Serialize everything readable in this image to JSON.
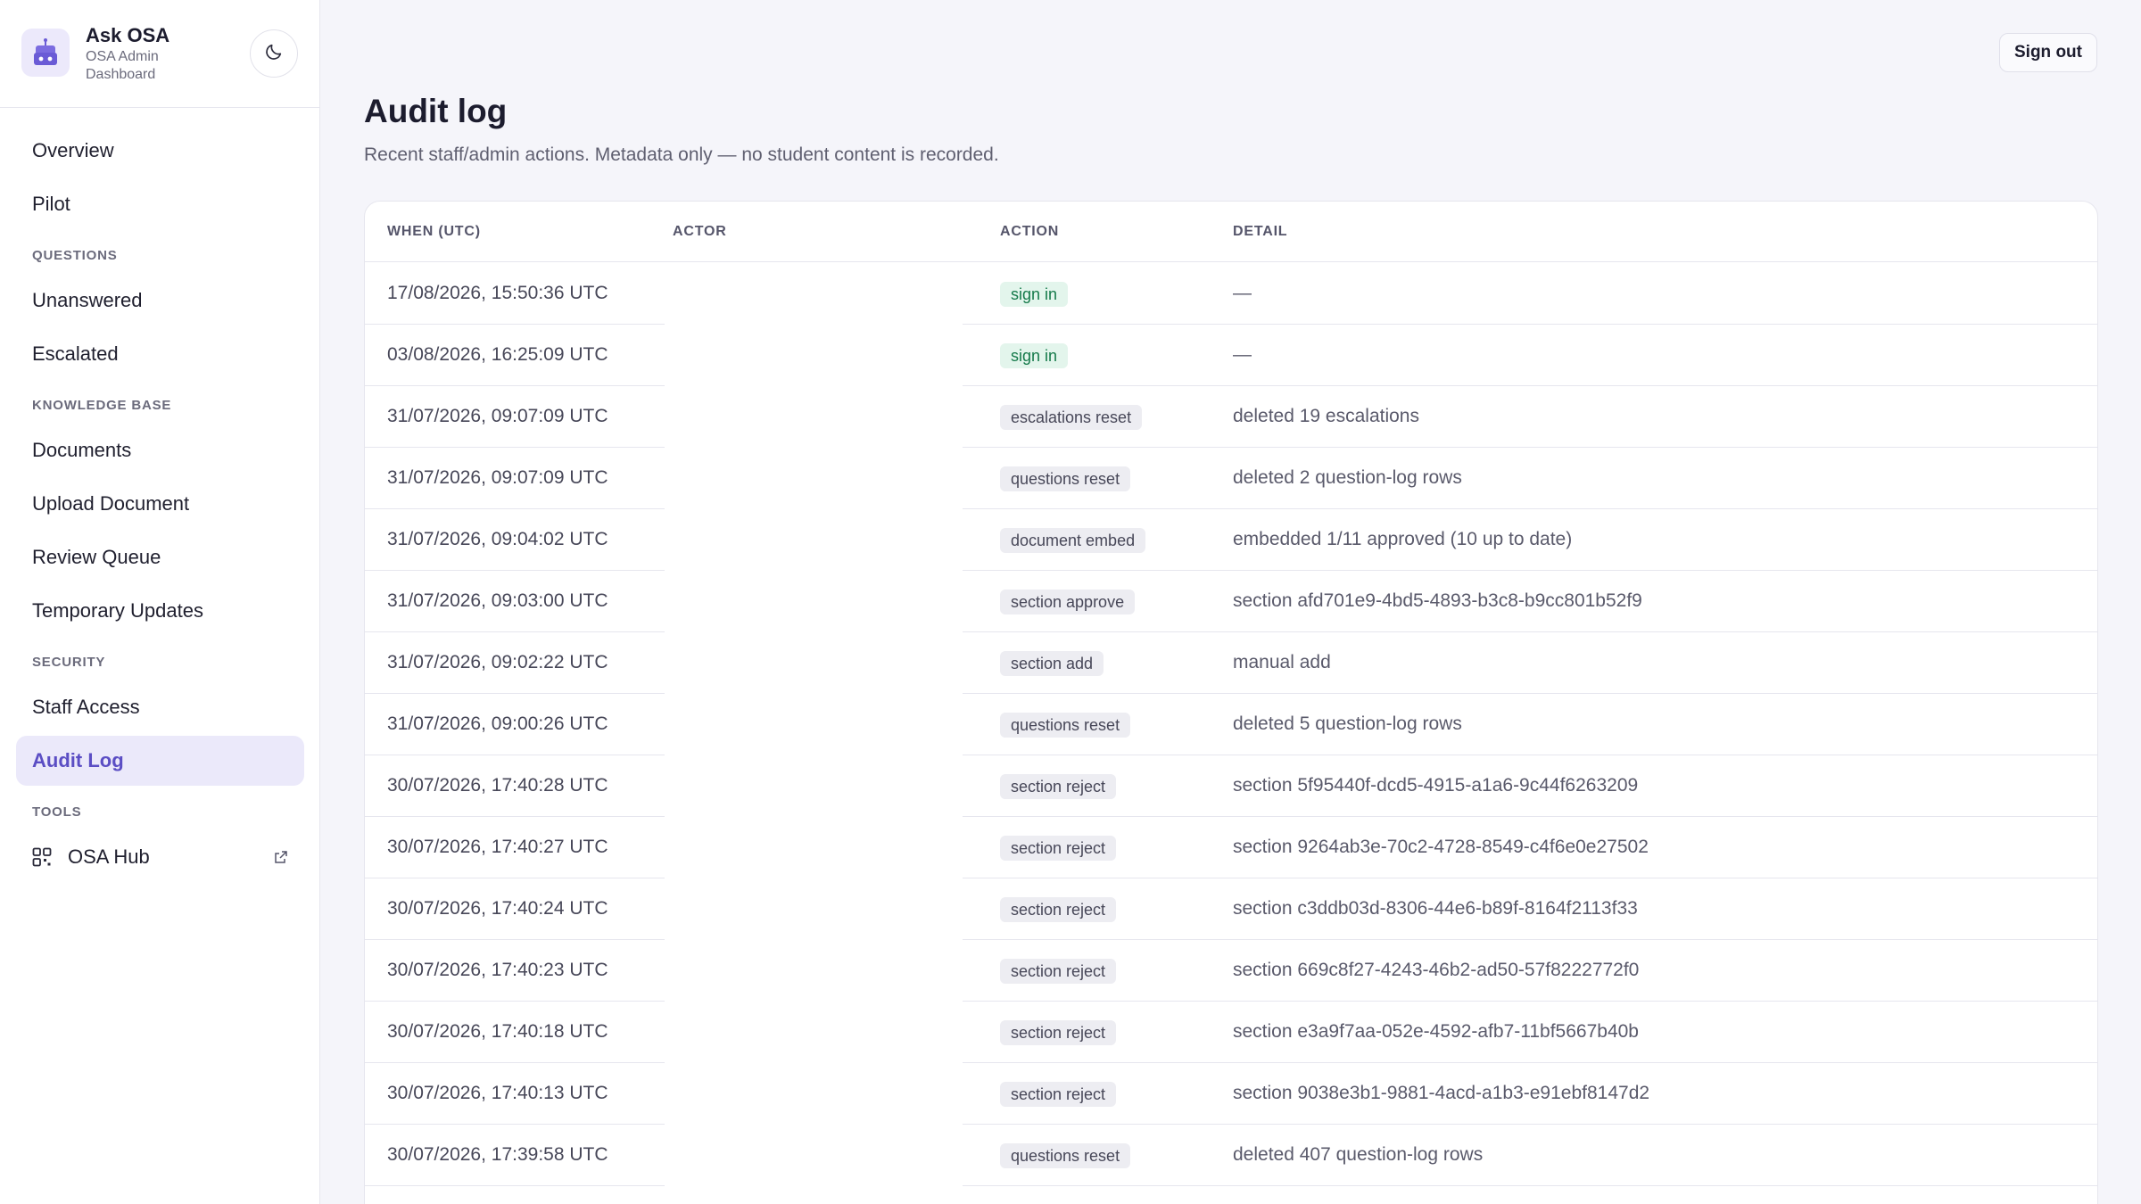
{
  "brand": {
    "title": "Ask OSA",
    "subtitle": "OSA Admin Dashboard"
  },
  "topbar": {
    "signout_label": "Sign out"
  },
  "sidebar": {
    "groups": [
      {
        "section": "",
        "items": [
          {
            "label": "Overview",
            "active": false
          },
          {
            "label": "Pilot",
            "active": false
          }
        ]
      },
      {
        "section": "QUESTIONS",
        "items": [
          {
            "label": "Unanswered",
            "active": false
          },
          {
            "label": "Escalated",
            "active": false
          }
        ]
      },
      {
        "section": "KNOWLEDGE BASE",
        "items": [
          {
            "label": "Documents",
            "active": false
          },
          {
            "label": "Upload Document",
            "active": false
          },
          {
            "label": "Review Queue",
            "active": false
          },
          {
            "label": "Temporary Updates",
            "active": false
          }
        ]
      },
      {
        "section": "SECURITY",
        "items": [
          {
            "label": "Staff Access",
            "active": false
          },
          {
            "label": "Audit Log",
            "active": true
          }
        ]
      },
      {
        "section": "TOOLS",
        "items": [
          {
            "label": "OSA Hub",
            "active": false,
            "icon": "grid-icon",
            "external": true
          }
        ]
      }
    ]
  },
  "main": {
    "title": "Audit log",
    "subtitle": "Recent staff/admin actions. Metadata only — no student content is recorded."
  },
  "table": {
    "headers": [
      "WHEN (UTC)",
      "ACTOR",
      "ACTION",
      "DETAIL"
    ],
    "rows": [
      {
        "when": "17/08/2026, 15:50:36 UTC",
        "actor": "",
        "action": "sign in",
        "detail": "—"
      },
      {
        "when": "03/08/2026, 16:25:09 UTC",
        "actor": "",
        "action": "sign in",
        "detail": "—"
      },
      {
        "when": "31/07/2026, 09:07:09 UTC",
        "actor": "",
        "action": "escalations reset",
        "detail": "deleted 19 escalations"
      },
      {
        "when": "31/07/2026, 09:07:09 UTC",
        "actor": "",
        "action": "questions reset",
        "detail": "deleted 2 question-log rows"
      },
      {
        "when": "31/07/2026, 09:04:02 UTC",
        "actor": "",
        "action": "document embed",
        "detail": "embedded 1/11 approved (10 up to date)"
      },
      {
        "when": "31/07/2026, 09:03:00 UTC",
        "actor": "",
        "action": "section approve",
        "detail": "section afd701e9-4bd5-4893-b3c8-b9cc801b52f9"
      },
      {
        "when": "31/07/2026, 09:02:22 UTC",
        "actor": "",
        "action": "section add",
        "detail": "manual add"
      },
      {
        "when": "31/07/2026, 09:00:26 UTC",
        "actor": "",
        "action": "questions reset",
        "detail": "deleted 5 question-log rows"
      },
      {
        "when": "30/07/2026, 17:40:28 UTC",
        "actor": "",
        "action": "section reject",
        "detail": "section 5f95440f-dcd5-4915-a1a6-9c44f6263209"
      },
      {
        "when": "30/07/2026, 17:40:27 UTC",
        "actor": "",
        "action": "section reject",
        "detail": "section 9264ab3e-70c2-4728-8549-c4f6e0e27502"
      },
      {
        "when": "30/07/2026, 17:40:24 UTC",
        "actor": "",
        "action": "section reject",
        "detail": "section c3ddb03d-8306-44e6-b89f-8164f2113f33"
      },
      {
        "when": "30/07/2026, 17:40:23 UTC",
        "actor": "",
        "action": "section reject",
        "detail": "section 669c8f27-4243-46b2-ad50-57f8222772f0"
      },
      {
        "when": "30/07/2026, 17:40:18 UTC",
        "actor": "",
        "action": "section reject",
        "detail": "section e3a9f7aa-052e-4592-afb7-11bf5667b40b"
      },
      {
        "when": "30/07/2026, 17:40:13 UTC",
        "actor": "",
        "action": "section reject",
        "detail": "section 9038e3b1-9881-4acd-a1b3-e91ebf8147d2"
      },
      {
        "when": "30/07/2026, 17:39:58 UTC",
        "actor": "",
        "action": "questions reset",
        "detail": "deleted 407 question-log rows"
      }
    ]
  },
  "colors": {
    "accent": "#5b4ec4",
    "accent_bg": "#ebe9fa",
    "success_bg": "#e3f5ec",
    "success_text": "#157a4a"
  }
}
